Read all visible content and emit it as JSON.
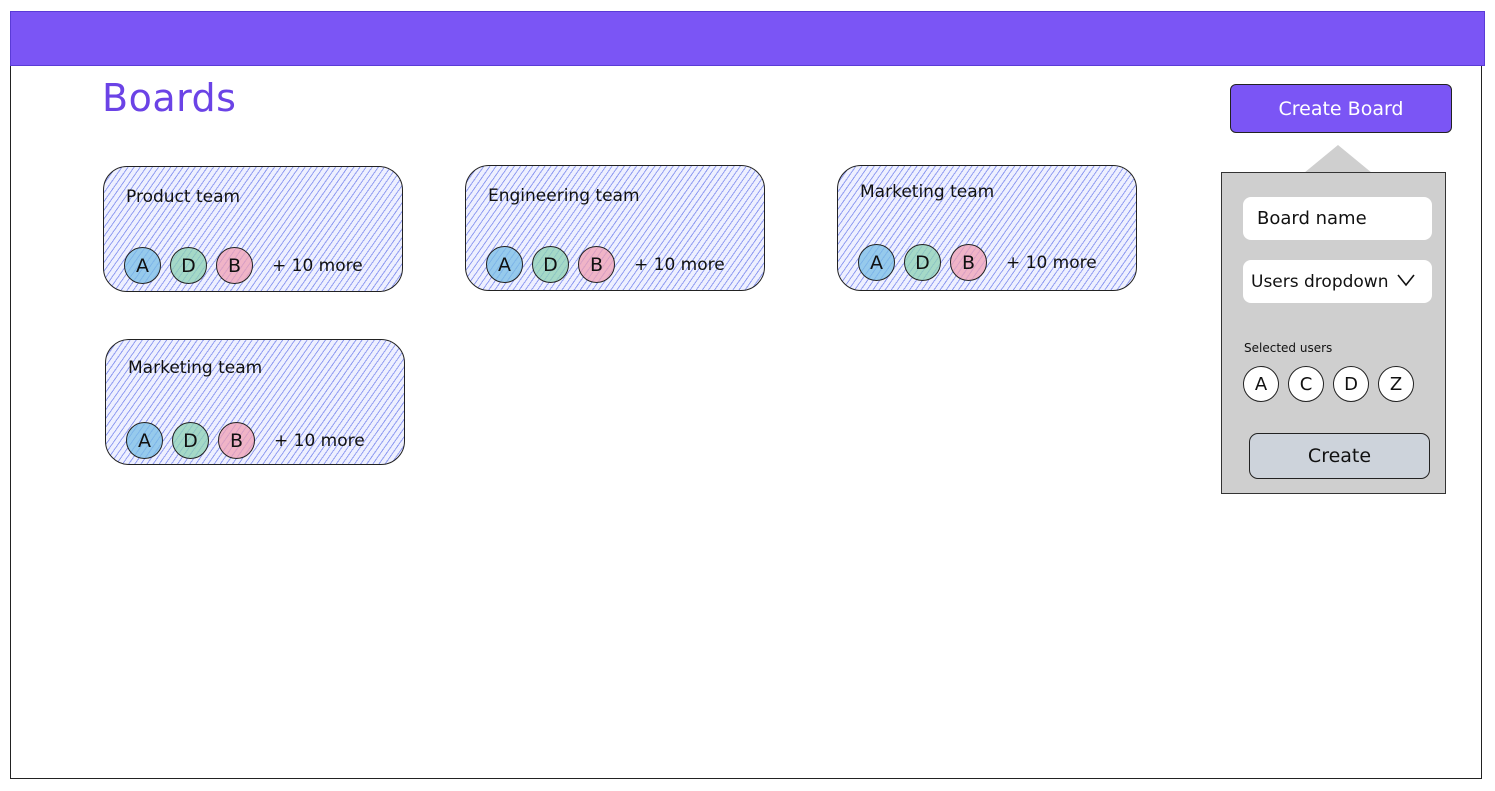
{
  "page": {
    "title": "Boards"
  },
  "header": {
    "create_board_label": "Create Board"
  },
  "boards": [
    {
      "name": "Product team",
      "avatars": [
        "A",
        "D",
        "B"
      ],
      "more": "+ 10 more"
    },
    {
      "name": "Engineering team",
      "avatars": [
        "A",
        "D",
        "B"
      ],
      "more": "+ 10 more"
    },
    {
      "name": "Marketing team",
      "avatars": [
        "A",
        "D",
        "B"
      ],
      "more": "+ 10 more"
    },
    {
      "name": "Marketing team",
      "avatars": [
        "A",
        "D",
        "B"
      ],
      "more": "+ 10 more"
    }
  ],
  "create_form": {
    "board_name_placeholder": "Board name",
    "users_dropdown_label": "Users dropdown",
    "dropdown_icon": "chevron-down-icon",
    "selected_users_label": "Selected users",
    "selected_users": [
      "A",
      "C",
      "D",
      "Z"
    ],
    "create_label": "Create"
  },
  "colors": {
    "brand": "#7b55f5",
    "avatar_a": "#78bee6",
    "avatar_d": "#8cd2b4",
    "avatar_b": "#f0a0b4",
    "popover_bg": "#cfcfcf"
  }
}
